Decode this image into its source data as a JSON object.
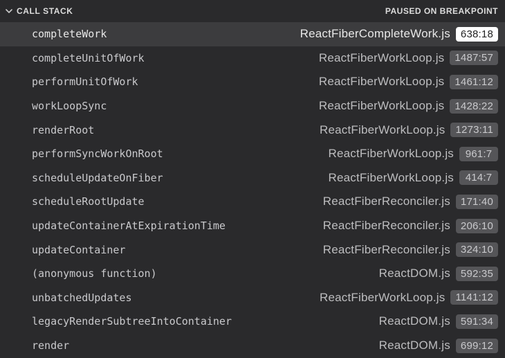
{
  "header": {
    "title": "CALL STACK",
    "status": "PAUSED ON BREAKPOINT"
  },
  "frames": [
    {
      "fn": "completeWork",
      "file": "ReactFiberCompleteWork.js",
      "loc": "638:18",
      "selected": true
    },
    {
      "fn": "completeUnitOfWork",
      "file": "ReactFiberWorkLoop.js",
      "loc": "1487:57",
      "selected": false
    },
    {
      "fn": "performUnitOfWork",
      "file": "ReactFiberWorkLoop.js",
      "loc": "1461:12",
      "selected": false
    },
    {
      "fn": "workLoopSync",
      "file": "ReactFiberWorkLoop.js",
      "loc": "1428:22",
      "selected": false
    },
    {
      "fn": "renderRoot",
      "file": "ReactFiberWorkLoop.js",
      "loc": "1273:11",
      "selected": false
    },
    {
      "fn": "performSyncWorkOnRoot",
      "file": "ReactFiberWorkLoop.js",
      "loc": "961:7",
      "selected": false
    },
    {
      "fn": "scheduleUpdateOnFiber",
      "file": "ReactFiberWorkLoop.js",
      "loc": "414:7",
      "selected": false
    },
    {
      "fn": "scheduleRootUpdate",
      "file": "ReactFiberReconciler.js",
      "loc": "171:40",
      "selected": false
    },
    {
      "fn": "updateContainerAtExpirationTime",
      "file": "ReactFiberReconciler.js",
      "loc": "206:10",
      "selected": false
    },
    {
      "fn": "updateContainer",
      "file": "ReactFiberReconciler.js",
      "loc": "324:10",
      "selected": false
    },
    {
      "fn": "(anonymous function)",
      "file": "ReactDOM.js",
      "loc": "592:35",
      "selected": false
    },
    {
      "fn": "unbatchedUpdates",
      "file": "ReactFiberWorkLoop.js",
      "loc": "1141:12",
      "selected": false
    },
    {
      "fn": "legacyRenderSubtreeIntoContainer",
      "file": "ReactDOM.js",
      "loc": "591:34",
      "selected": false
    },
    {
      "fn": "render",
      "file": "ReactDOM.js",
      "loc": "699:12",
      "selected": false
    }
  ]
}
